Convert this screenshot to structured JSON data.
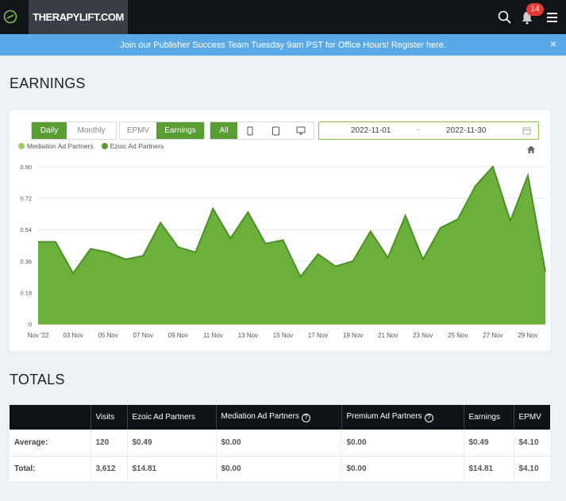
{
  "header": {
    "site_name": "THERAPYLIFT.COM",
    "notification_count": "14"
  },
  "banner": {
    "message": "Join our Publisher Success Team Tuesday 9am PST for Office Hours!",
    "link_text": "Register here.",
    "close": "×"
  },
  "earnings": {
    "title": "EARNINGS",
    "period_buttons": [
      "Daily",
      "Monthly"
    ],
    "metric_buttons": [
      "EPMV",
      "Earnings"
    ],
    "device_all": "All",
    "start_date": "2022-11-01",
    "date_separator": "~",
    "end_date": "2022-11-30",
    "legend": [
      {
        "label": "Mediation Ad Partners",
        "color": "#9ccc65"
      },
      {
        "label": "Ezoic Ad Partners",
        "color": "#5a9e33"
      }
    ]
  },
  "chart_data": {
    "type": "area",
    "x": [
      "Nov '22",
      "02 Nov",
      "03 Nov",
      "04 Nov",
      "05 Nov",
      "06 Nov",
      "07 Nov",
      "08 Nov",
      "09 Nov",
      "10 Nov",
      "11 Nov",
      "12 Nov",
      "13 Nov",
      "14 Nov",
      "15 Nov",
      "16 Nov",
      "17 Nov",
      "18 Nov",
      "19 Nov",
      "20 Nov",
      "21 Nov",
      "22 Nov",
      "23 Nov",
      "24 Nov",
      "25 Nov",
      "26 Nov",
      "27 Nov",
      "28 Nov",
      "29 Nov",
      "30 Nov"
    ],
    "tick_labels": [
      "Nov '22",
      "03 Nov",
      "05 Nov",
      "07 Nov",
      "09 Nov",
      "11 Nov",
      "13 Nov",
      "15 Nov",
      "17 Nov",
      "19 Nov",
      "21 Nov",
      "23 Nov",
      "25 Nov",
      "27 Nov",
      "29 Nov"
    ],
    "series": [
      {
        "name": "Mediation Ad Partners",
        "values": [
          0,
          0,
          0,
          0,
          0,
          0,
          0,
          0,
          0,
          0,
          0,
          0,
          0,
          0,
          0,
          0,
          0,
          0,
          0,
          0,
          0,
          0,
          0,
          0,
          0,
          0,
          0,
          0,
          0,
          0
        ]
      },
      {
        "name": "Ezoic Ad Partners",
        "values": [
          0.47,
          0.47,
          0.29,
          0.43,
          0.41,
          0.37,
          0.39,
          0.58,
          0.44,
          0.41,
          0.66,
          0.49,
          0.64,
          0.46,
          0.48,
          0.27,
          0.4,
          0.33,
          0.36,
          0.53,
          0.38,
          0.62,
          0.37,
          0.55,
          0.6,
          0.79,
          0.9,
          0.59,
          0.85,
          0.3
        ]
      }
    ],
    "yticks": [
      "0",
      "0.18",
      "0.36",
      "0.54",
      "0.72",
      "0.90"
    ],
    "ylim": [
      0,
      0.9
    ],
    "grid": true
  },
  "totals": {
    "title": "TOTALS",
    "columns": [
      "",
      "Visits",
      "Ezoic Ad Partners",
      "Mediation Ad Partners",
      "Premium Ad Partners",
      "Earnings",
      "EPMV"
    ],
    "rows": [
      [
        "Average:",
        "120",
        "$0.49",
        "$0.00",
        "$0.00",
        "$0.49",
        "$4.10"
      ],
      [
        "Total:",
        "3,612",
        "$14.81",
        "$0.00",
        "$0.00",
        "$14.81",
        "$4.10"
      ]
    ]
  }
}
